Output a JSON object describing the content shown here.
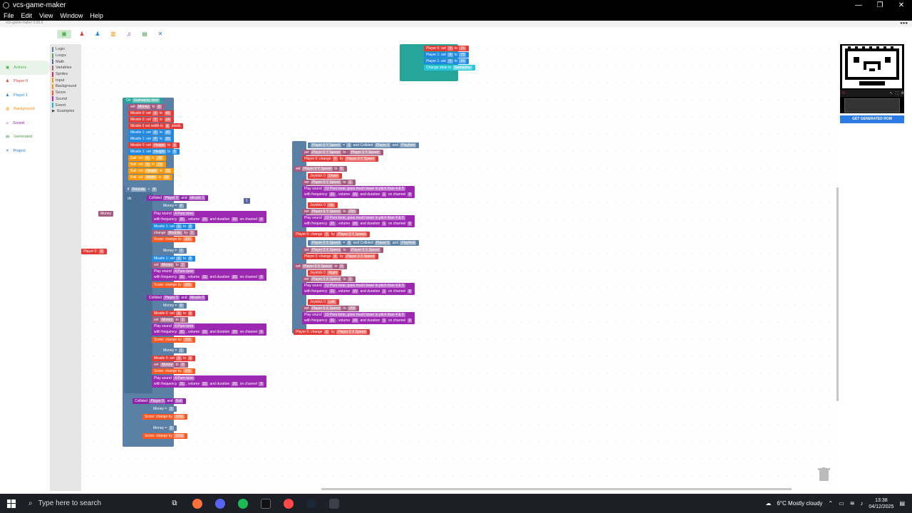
{
  "window": {
    "title": "vcs-game-maker",
    "version": "vcs-game-maker 0.55.6"
  },
  "menu": [
    "File",
    "Edit",
    "View",
    "Window",
    "Help"
  ],
  "leftnav": [
    {
      "label": "Actions",
      "color": "#4caf50"
    },
    {
      "label": "Player 0",
      "color": "#e53935"
    },
    {
      "label": "Player 1",
      "color": "#1e88e5"
    },
    {
      "label": "Background",
      "color": "#fb8c00"
    },
    {
      "label": "Sound",
      "color": "#8e24aa"
    },
    {
      "label": "Generated",
      "color": "#43a047"
    },
    {
      "label": "Project",
      "color": "#1976d2"
    }
  ],
  "toolbox": [
    {
      "label": "Logic",
      "color": "#5b80a5"
    },
    {
      "label": "Loops",
      "color": "#5ba55b"
    },
    {
      "label": "Math",
      "color": "#5b67a5"
    },
    {
      "label": "Variables",
      "color": "#a55b80"
    },
    {
      "label": "Sprites",
      "color": "#e91e63"
    },
    {
      "label": "Input",
      "color": "#ff9800"
    },
    {
      "label": "Background",
      "color": "#ff9800"
    },
    {
      "label": "Score",
      "color": "#ff5722"
    },
    {
      "label": "Sound",
      "color": "#9c27b0"
    },
    {
      "label": "Event",
      "color": "#00bcd4"
    },
    {
      "label": "Examples",
      "color": "#444"
    }
  ],
  "blocks": {
    "top": [
      {
        "text": "Player 0: set",
        "slot": "Y",
        "tail": "to",
        "val": "75",
        "color": "#e53935"
      },
      {
        "text": "Player 1: set",
        "slot": "X",
        "tail": "to",
        "val": "73",
        "color": "#1e88e5"
      },
      {
        "text": "Player 1: set",
        "slot": "Y",
        "tail": "to",
        "val": "24",
        "color": "#1e88e5"
      },
      {
        "text": "Change state to",
        "slot": "Gameplay",
        "tail": "",
        "val": "",
        "color": "#26c6da"
      }
    ],
    "event_header": "On",
    "event_slot": "Gameplay start",
    "set_money": {
      "text": "set",
      "var": "Money",
      "tail": "to",
      "val": "0"
    },
    "init": [
      {
        "text": "Missile 0: set",
        "slot": "X",
        "tail": "to",
        "val": "42",
        "color": "#e53935"
      },
      {
        "text": "Missile 0: set",
        "slot": "Y",
        "tail": "to",
        "val": "14",
        "color": "#e53935"
      },
      {
        "text": "Missile 0 set width to",
        "slot": "8",
        "tail": "pixels",
        "val": "",
        "color": "#e53935"
      },
      {
        "text": "Missile 1: set",
        "slot": "X",
        "tail": "to",
        "val": "30",
        "color": "#1e88e5"
      },
      {
        "text": "Missile 1: set",
        "slot": "Y",
        "tail": "to",
        "val": "10",
        "color": "#1e88e5"
      },
      {
        "text": "Missile 0: set",
        "slot": "Height",
        "tail": "to",
        "val": "5",
        "color": "#e53935"
      },
      {
        "text": "Missile 1: set",
        "slot": "Height",
        "tail": "to",
        "val": "5",
        "color": "#1e88e5"
      },
      {
        "text": "Ball: set",
        "slot": "Y",
        "tail": "to",
        "val": "76",
        "color": "#ff9800"
      },
      {
        "text": "Ball: set",
        "slot": "X",
        "tail": "to",
        "val": "73",
        "color": "#ff9800"
      },
      {
        "text": "Ball: set",
        "slot": "Height",
        "tail": "to",
        "val": "13",
        "color": "#ff9800"
      },
      {
        "text": "Ball: set",
        "slot": "Width",
        "tail": "to",
        "val": "20",
        "color": "#ff9800"
      }
    ],
    "if_rounds": {
      "var": "Rounds",
      "op": "<",
      "val": "4"
    },
    "collided_1": {
      "text": "Collided",
      "a": "Player 0",
      "b": "Missile 1"
    },
    "money_eq": {
      "var": "Money",
      "op": "=",
      "val": "0"
    },
    "money_var_float": "Money",
    "player0_x_float": {
      "text": "Player 0:",
      "slot": "X"
    },
    "badge_1": "1",
    "sound_block": {
      "line1": "Play sound",
      "tone": "4 Pure tone",
      "line2": "with frequency",
      "freq": "31",
      "vol_lbl": ", volume",
      "vol": "15",
      "dur_lbl": "and duration",
      "dur": "20",
      "ch_lbl": "on channel",
      "ch": "0"
    },
    "missile1_set": {
      "text": "Missile 1: set",
      "slot": "X",
      "tail": "to",
      "val": "0"
    },
    "change_rounds": {
      "text": "change",
      "var": "Rounds",
      "tail": "by",
      "val": "1"
    },
    "score_change_200": {
      "text": "Score: change by",
      "val": "200"
    },
    "money_eq_1": {
      "var": "Money",
      "op": "=",
      "val": "1"
    },
    "set_money_2": {
      "text": "set",
      "var": "Money",
      "tail": "to",
      "val": "2"
    },
    "collided_2": {
      "text": "Collided",
      "a": "Player 0",
      "b": "Missile 0"
    },
    "missile0_set": {
      "text": "Missile 0: set",
      "slot": "X",
      "tail": "to",
      "val": "0"
    },
    "set_money_1": {
      "text": "set",
      "var": "Money",
      "tail": "to",
      "val": "1"
    },
    "money_eq_2": {
      "var": "Money",
      "op": "=",
      "val": "2"
    },
    "set_money_0": {
      "text": "set",
      "var": "Money",
      "tail": "to",
      "val": "0"
    },
    "collided_ball": {
      "text": "Collided",
      "a": "Player 0",
      "b": "Ball"
    },
    "score_change_1000": {
      "text": "Score: change by",
      "val": "1000"
    },
    "score_change_2500": {
      "text": "Score: change by",
      "val": "2500"
    },
    "right": {
      "if_y": {
        "a": "Player 0 Y Speed",
        "op": "=",
        "val": "0",
        "and": "and",
        "c": "Collided",
        "p": "Player 0",
        "pf": "Playfield"
      },
      "set_y_speed_to_y": {
        "text": "set",
        "var": "Player 0 Y Speed",
        "tail": "to",
        "op": "-",
        "v2": "Player 0 Y Speed"
      },
      "change_y": {
        "text": "Player 0: change",
        "slot": "Y",
        "tail": "by",
        "var": "Player 0 Y Speed"
      },
      "set_y_speed_0": {
        "text": "set",
        "var": "Player 0 Y Speed",
        "tail": "to",
        "val": "0"
      },
      "joy_down": {
        "text": "Joystick 0",
        "dir": "Down"
      },
      "set_y_speed_1": {
        "text": "set",
        "var": "Player 0 Y Speed",
        "tail": "to",
        "val": "1"
      },
      "sound2": {
        "line1": "Play sound",
        "tone": "12 Pure tone, goes much lower in pitch than 4 & 5",
        "line2": "with frequency",
        "freq": "31",
        "vol_lbl": ", volume",
        "vol": "15",
        "dur_lbl": "and duration",
        "dur": "1",
        "ch_lbl": "on channel",
        "ch": "0"
      },
      "joy_up": {
        "text": "Joystick 0",
        "dir": "Up"
      },
      "set_y_speed_255": {
        "text": "set",
        "var": "Player 0 Y Speed",
        "tail": "to",
        "val": "255"
      },
      "if_x": {
        "a": "Player 0 X Speed",
        "op": "=",
        "val": "0",
        "and": "and",
        "c": "Collided",
        "p": "Player 0",
        "pf": "Playfield"
      },
      "set_x_speed_to_x": {
        "text": "set",
        "var": "Player 0 X Speed",
        "tail": "to",
        "op": "-",
        "v2": "Player 0 X Speed"
      },
      "change_x": {
        "text": "Player 0: change",
        "slot": "X",
        "tail": "by",
        "var": "Player 0 X Speed"
      },
      "set_x_speed_0": {
        "text": "set",
        "var": "Player 0 X Speed",
        "tail": "to",
        "val": "0"
      },
      "joy_right": {
        "text": "Joystick 0",
        "dir": "Right"
      },
      "set_x_speed_1": {
        "text": "set",
        "var": "Player 0 X Speed",
        "tail": "to",
        "val": "1"
      },
      "joy_left": {
        "text": "Joystick 0",
        "dir": "Left"
      },
      "set_x_speed_255": {
        "text": "set",
        "var": "Player 0 X Speed",
        "tail": "to",
        "val": "255"
      }
    },
    "labels": {
      "if": "if",
      "do": "do"
    }
  },
  "get_rom_button": "GET GENERATED ROM",
  "taskbar": {
    "search_placeholder": "Type here to search",
    "weather": "6°C  Mostly cloudy",
    "time": "13:38",
    "date": "04/12/2025"
  }
}
